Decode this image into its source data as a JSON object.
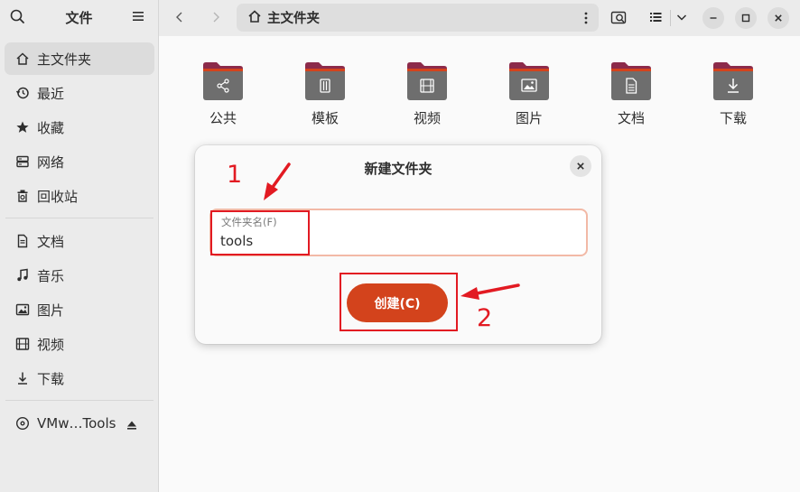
{
  "sidebar": {
    "title": "文件",
    "items": [
      {
        "label": "主文件夹",
        "icon": "home-icon",
        "active": true
      },
      {
        "label": "最近",
        "icon": "recent-icon"
      },
      {
        "label": "收藏",
        "icon": "star-icon"
      },
      {
        "label": "网络",
        "icon": "network-icon"
      },
      {
        "label": "回收站",
        "icon": "trash-icon"
      },
      {
        "label": "文档",
        "icon": "document-icon"
      },
      {
        "label": "音乐",
        "icon": "music-icon"
      },
      {
        "label": "图片",
        "icon": "picture-icon"
      },
      {
        "label": "视频",
        "icon": "video-icon"
      },
      {
        "label": "下载",
        "icon": "download-icon"
      },
      {
        "label": "VMw…Tools",
        "icon": "disc-icon"
      }
    ]
  },
  "header": {
    "path_label": "主文件夹"
  },
  "folders": [
    {
      "label": "公共",
      "icon": "share-icon"
    },
    {
      "label": "模板",
      "icon": "template-icon"
    },
    {
      "label": "视频",
      "icon": "video-icon"
    },
    {
      "label": "图片",
      "icon": "picture-icon"
    },
    {
      "label": "文档",
      "icon": "document-icon"
    },
    {
      "label": "下载",
      "icon": "download-icon"
    }
  ],
  "dialog": {
    "title": "新建文件夹",
    "field_label": "文件夹名(F)",
    "field_value": "tools",
    "create_label": "创建(C)"
  },
  "annotations": {
    "step1": "1",
    "step2": "2"
  },
  "colors": {
    "accent": "#d3431c",
    "folder": "#8c2a4a",
    "folder_body": "#6e6e6e",
    "annotation": "#e21a22"
  }
}
